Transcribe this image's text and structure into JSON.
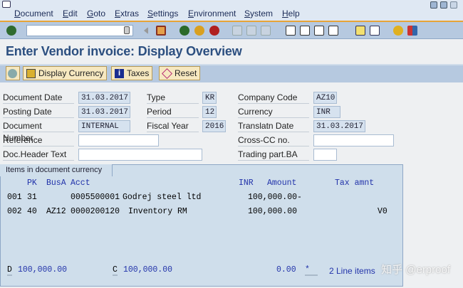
{
  "menu": [
    "Document",
    "Edit",
    "Goto",
    "Extras",
    "Settings",
    "Environment",
    "System",
    "Help"
  ],
  "title": "Enter Vendor invoice: Display Overview",
  "app_toolbar": {
    "display_currency": "Display Currency",
    "taxes": "Taxes",
    "reset": "Reset"
  },
  "form": {
    "document_date": {
      "label": "Document Date",
      "value": "31.03.2017"
    },
    "posting_date": {
      "label": "Posting Date",
      "value": "31.03.2017"
    },
    "document_number": {
      "label": "Document Number",
      "value": "INTERNAL"
    },
    "reference": {
      "label": "Reference",
      "value": ""
    },
    "doc_header_text": {
      "label": "Doc.Header Text",
      "value": ""
    },
    "type": {
      "label": "Type",
      "value": "KR"
    },
    "period": {
      "label": "Period",
      "value": "12"
    },
    "fiscal_year": {
      "label": "Fiscal Year",
      "value": "2016"
    },
    "company_code": {
      "label": "Company Code",
      "value": "AZ10"
    },
    "currency": {
      "label": "Currency",
      "value": "INR"
    },
    "translatn_date": {
      "label": "Translatn Date",
      "value": "31.03.2017"
    },
    "cross_cc": {
      "label": "Cross-CC no.",
      "value": ""
    },
    "trading_part": {
      "label": "Trading part.BA",
      "value": ""
    }
  },
  "items": {
    "tab": "Items in document currency",
    "headers": {
      "pk": "PK",
      "busa": "BusA",
      "acct": "Acct",
      "cur": "INR",
      "amount": "Amount",
      "tax": "Tax amnt"
    },
    "rows": [
      {
        "no": "001",
        "pk": "31",
        "busa": "",
        "acct": "0005500001",
        "text": "Godrej steel ltd",
        "amount": "100,000.00-",
        "tax": ""
      },
      {
        "no": "002",
        "pk": "40",
        "busa": "AZ12",
        "acct": "0000200120",
        "text": "Inventory RM",
        "amount": "100,000.00",
        "tax": "V0"
      }
    ],
    "footer": {
      "d_label": "D",
      "debit": "100,000.00",
      "c_label": "C",
      "credit": "100,000.00",
      "balance": "0.00",
      "star": "*",
      "line_items": "2 Line items"
    }
  },
  "watermark": "知乎 @erproof"
}
